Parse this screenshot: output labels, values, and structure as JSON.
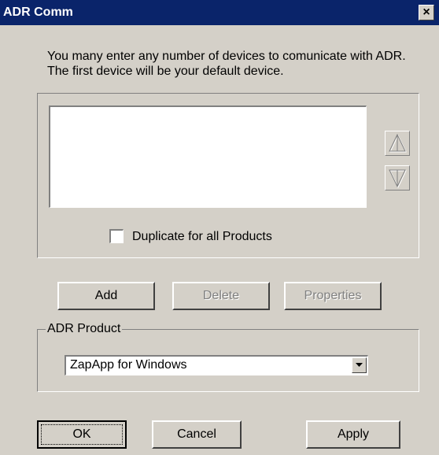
{
  "window": {
    "title": "ADR Comm",
    "close_label": "×"
  },
  "intro_text": "You many enter any number of devices to comunicate with ADR.  The first device will be your default device.",
  "devices": {
    "items": []
  },
  "checkbox": {
    "label": "Duplicate for all Products",
    "checked": false
  },
  "actions": {
    "add": "Add",
    "delete": "Delete",
    "properties": "Properties"
  },
  "product": {
    "group_label": "ADR Product",
    "selected": "ZapApp for Windows"
  },
  "footer": {
    "ok": "OK",
    "cancel": "Cancel",
    "apply": "Apply"
  },
  "icons": {
    "move_up": "arrow-up-icon",
    "move_down": "arrow-down-icon",
    "dropdown": "chevron-down-icon"
  },
  "colors": {
    "titlebar": "#0a246a",
    "face": "#d4d0c8"
  }
}
